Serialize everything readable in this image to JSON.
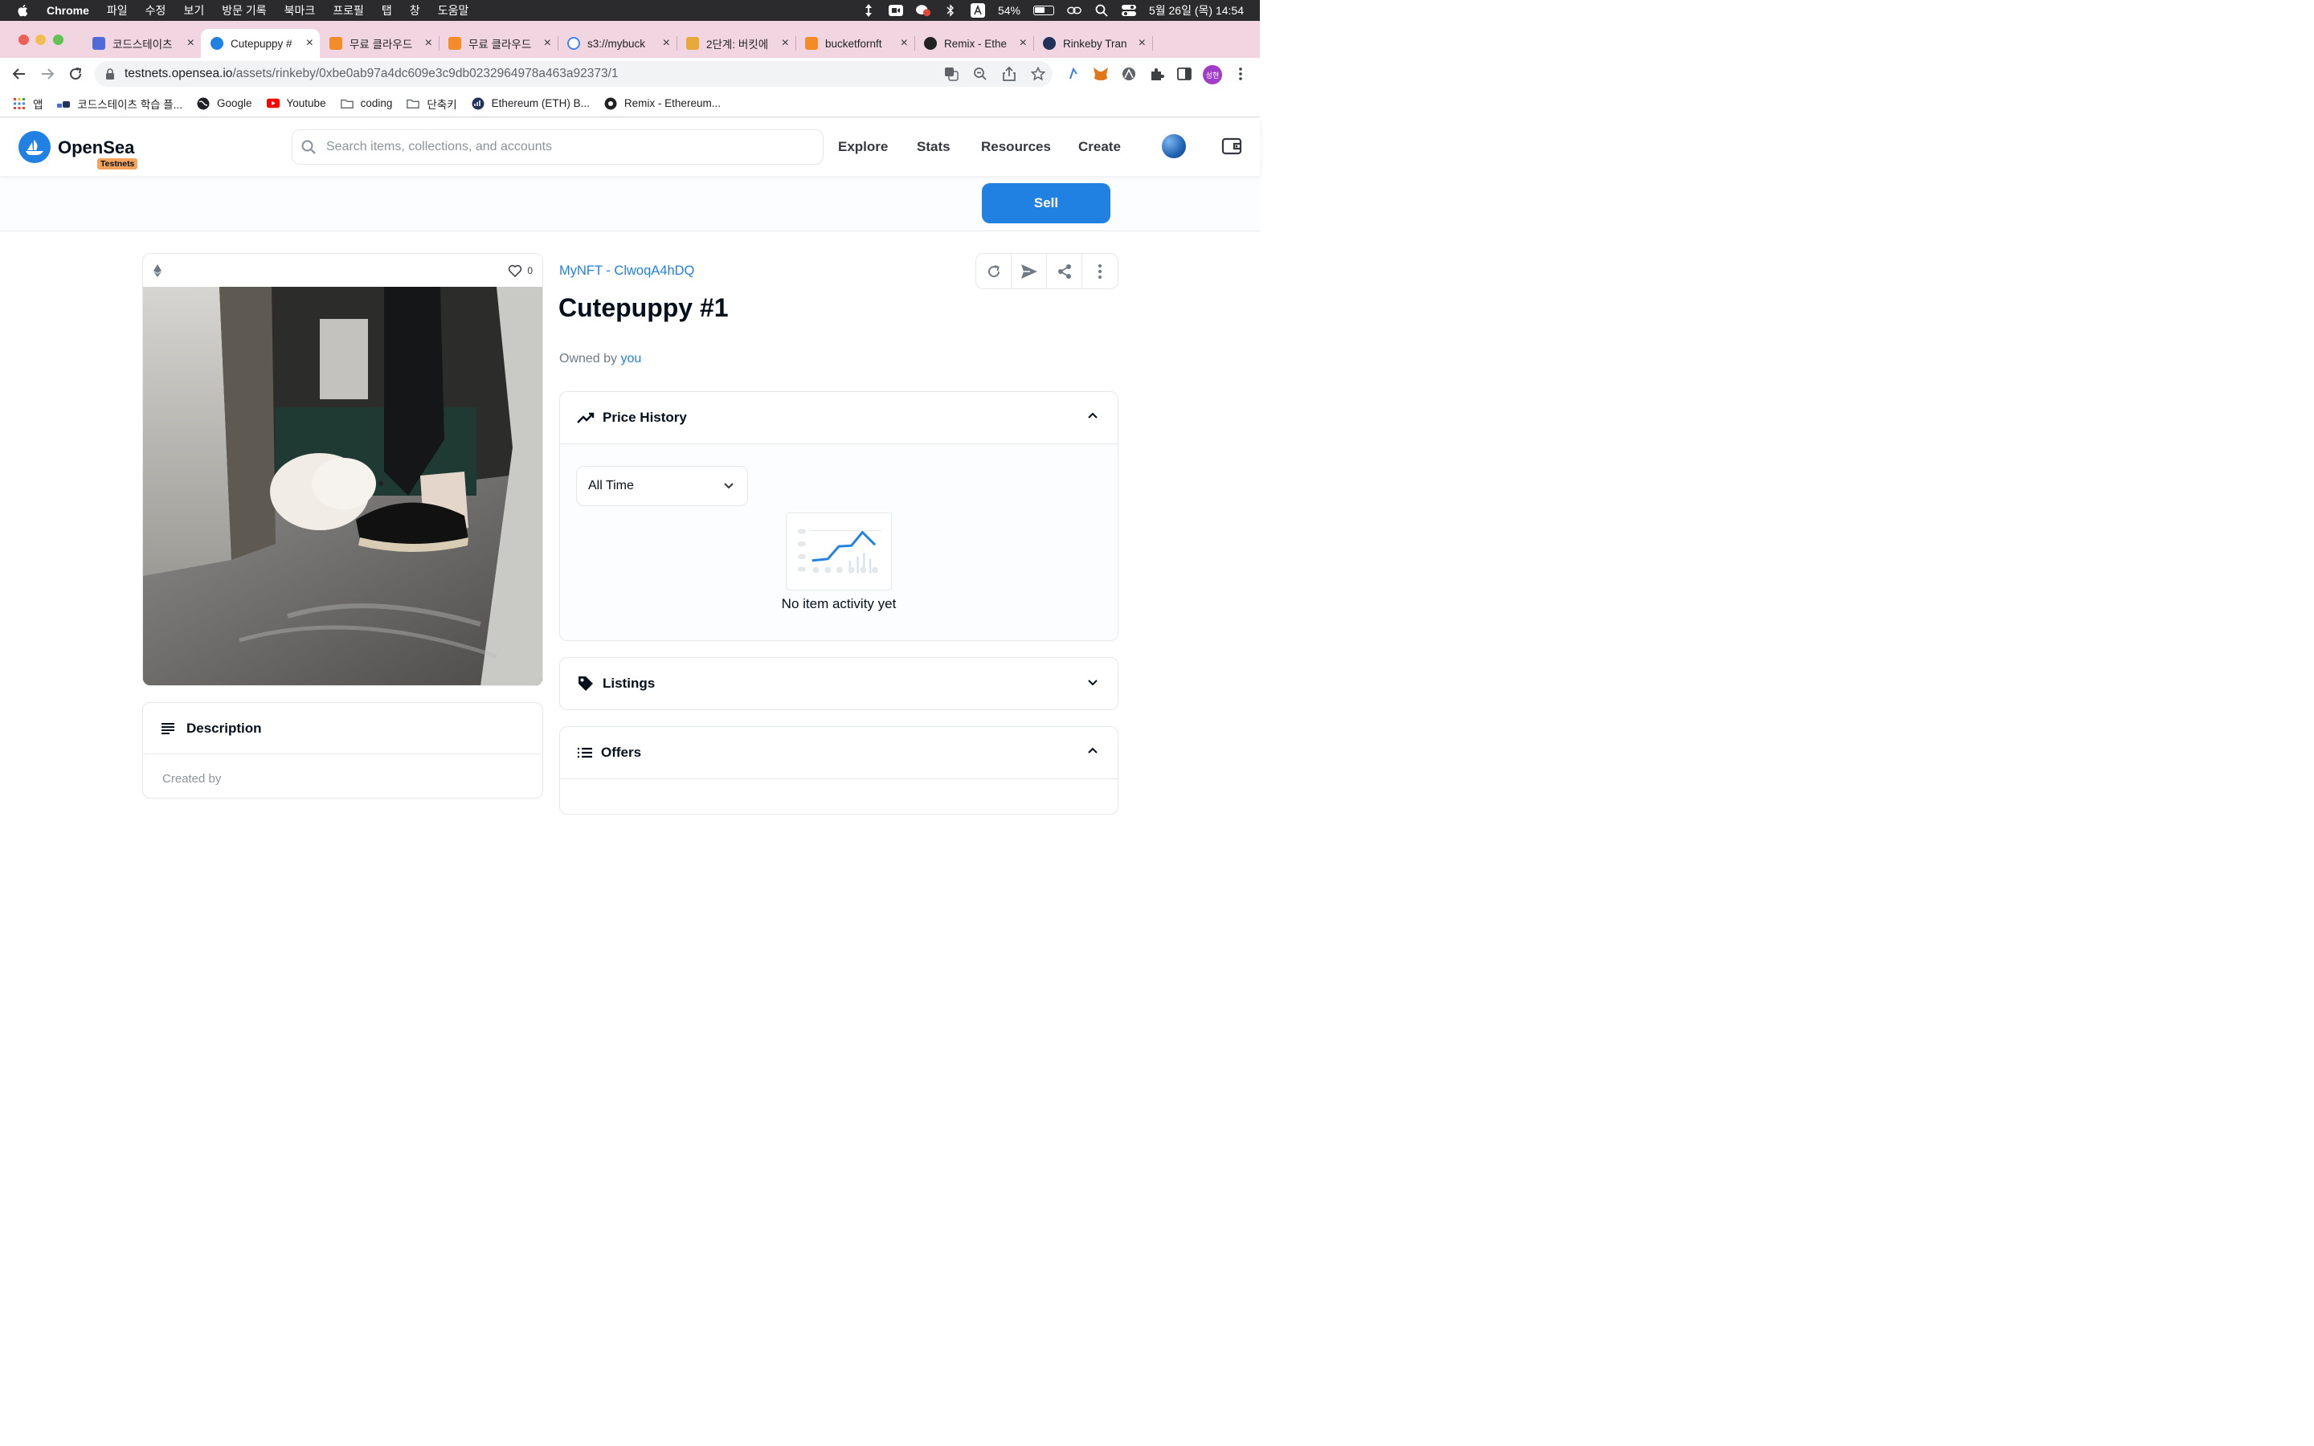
{
  "mac_menu": {
    "app": "Chrome",
    "items": [
      "파일",
      "수정",
      "보기",
      "방문 기록",
      "북마크",
      "프로필",
      "탭",
      "창",
      "도움말"
    ],
    "battery": "54%",
    "datetime": "5월 26일 (목)  14:54"
  },
  "tabs": [
    {
      "label": "코드스테이츠 ",
      "color": "#4f6bd8"
    },
    {
      "label": "Cutepuppy #",
      "color": "#2081e2",
      "active": true
    },
    {
      "label": "무료 클라우드 ",
      "color": "#f28b28"
    },
    {
      "label": "무료 클라우드 ",
      "color": "#f28b28"
    },
    {
      "label": "s3://mybuck",
      "color": "#4285f4"
    },
    {
      "label": "2단계: 버킷에 ",
      "color": "#e6a93a"
    },
    {
      "label": "bucketfornft",
      "color": "#f28b28"
    },
    {
      "label": "Remix - Ethe",
      "color": "#222222"
    },
    {
      "label": "Rinkeby Tran",
      "color": "#21325b"
    }
  ],
  "toolbar": {
    "url_host": "testnets.opensea.io",
    "url_path": "/assets/rinkeby/0xbe0ab97a4dc609e3c9db0232964978a463a92373/1",
    "profile_chip": "성현"
  },
  "bookmarks": [
    {
      "label": "앱",
      "icon": "apps-grid-icon"
    },
    {
      "label": "코드스테이츠 학습 플...",
      "icon": "codestates-icon"
    },
    {
      "label": "Google",
      "icon": "globe-icon"
    },
    {
      "label": "Youtube",
      "icon": "youtube-icon"
    },
    {
      "label": "coding",
      "icon": "folder-icon"
    },
    {
      "label": "단축키",
      "icon": "folder-icon"
    },
    {
      "label": "Ethereum (ETH) B...",
      "icon": "etherscan-icon"
    },
    {
      "label": "Remix - Ethereum...",
      "icon": "remix-icon"
    }
  ],
  "opensea": {
    "brand": "OpenSea",
    "badge": "Testnets",
    "search_placeholder": "Search items, collections, and accounts",
    "nav": [
      "Explore",
      "Stats",
      "Resources",
      "Create"
    ],
    "accent": "#2081e2"
  },
  "sell_label": "Sell",
  "asset": {
    "likes": "0",
    "collection": "MyNFT - ClwoqA4hDQ",
    "title": "Cutepuppy #1",
    "owned_prefix": "Owned by ",
    "owner": "you"
  },
  "price_history": {
    "title": "Price History",
    "range": "All Time",
    "empty": "No item activity yet"
  },
  "listings": {
    "title": "Listings"
  },
  "offers": {
    "title": "Offers"
  },
  "description": {
    "title": "Description",
    "body": "Created by"
  }
}
